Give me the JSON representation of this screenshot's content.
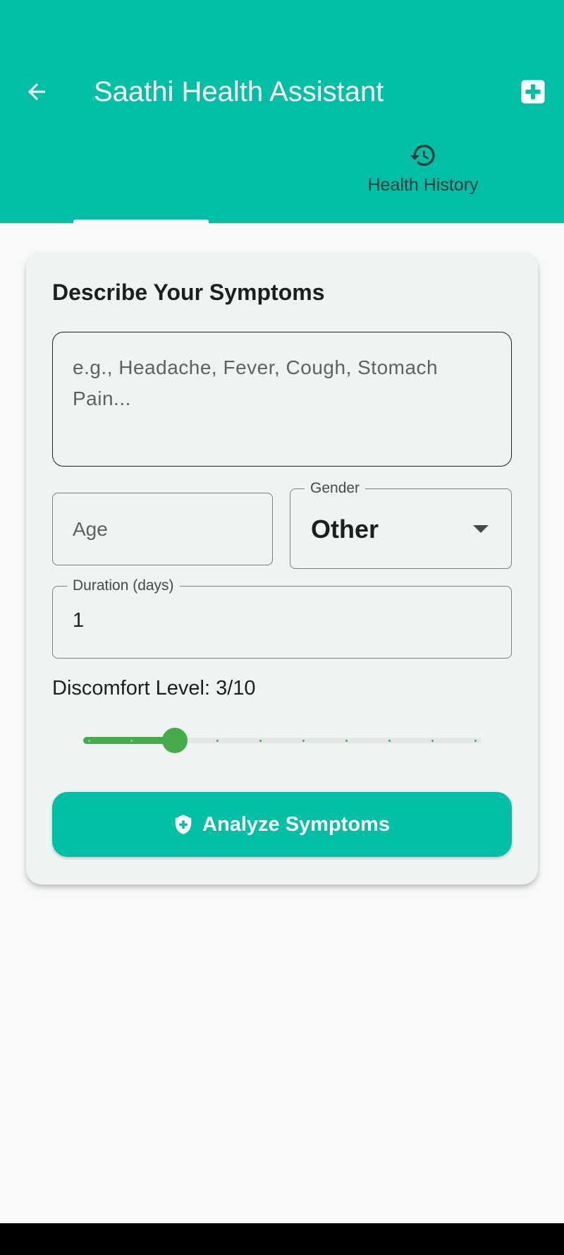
{
  "appbar": {
    "title": "Saathi Health Assistant",
    "back_icon": "arrow-back-icon",
    "action_icon": "medical-services-icon",
    "background_color": "#00bfa5"
  },
  "tabs": [
    {
      "label": "",
      "icon": "",
      "selected": true
    },
    {
      "label": "Health History",
      "icon": "history-icon",
      "selected": false
    }
  ],
  "form": {
    "title": "Describe Your Symptoms",
    "symptoms": {
      "placeholder": "e.g., Headache, Fever, Cough, Stomach Pain...",
      "value": ""
    },
    "age": {
      "placeholder": "Age",
      "value": ""
    },
    "gender": {
      "label": "Gender",
      "value": "Other"
    },
    "duration": {
      "label": "Duration (days)",
      "value": "1"
    },
    "discomfort": {
      "label": "Discomfort Level: 3/10",
      "value": 3,
      "min": 1,
      "max": 10,
      "active_color": "#45aa4c"
    },
    "submit": {
      "label": "Analyze Symptoms",
      "icon": "shield-plus-icon",
      "color": "#00bfa5"
    }
  }
}
